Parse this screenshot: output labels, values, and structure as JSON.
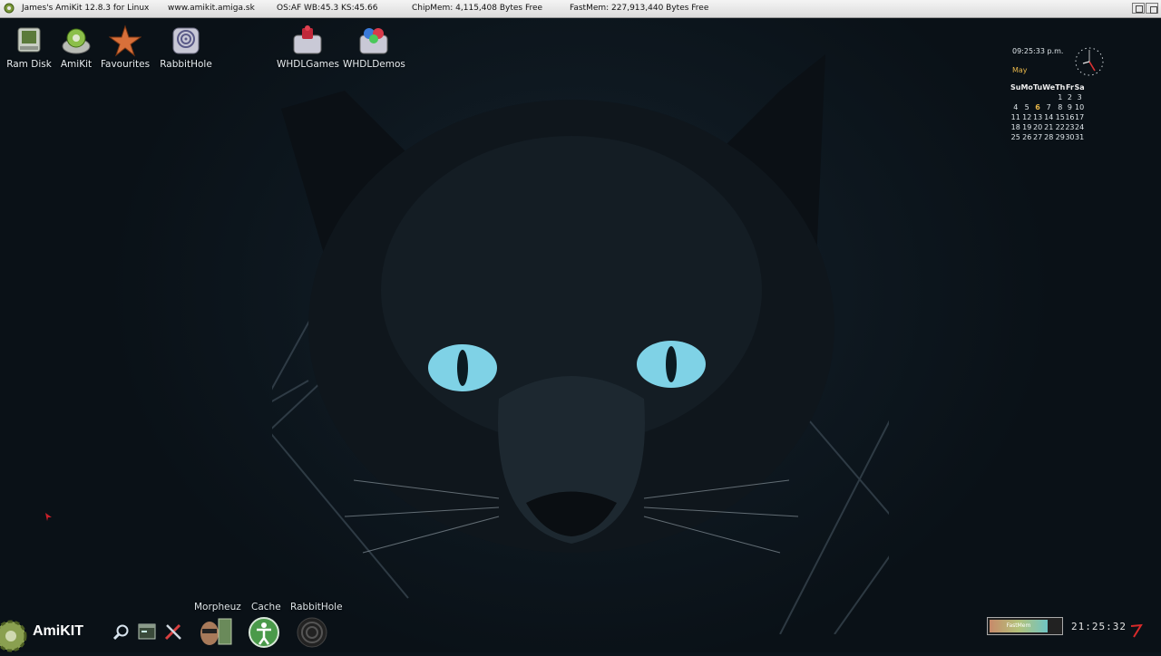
{
  "titlebar": {
    "title": "James's AmiKit 12.8.3 for Linux",
    "website": "www.amikit.amiga.sk",
    "versions": "OS:AF  WB:45.3  KS:45.66",
    "chipmem": "ChipMem: 4,115,408 Bytes Free",
    "fastmem": "FastMem: 227,913,440 Bytes Free"
  },
  "desktop_icons": [
    {
      "label": "Ram Disk",
      "icon": "ram-disk-icon"
    },
    {
      "label": "AmiKit",
      "icon": "amikit-drive-icon"
    },
    {
      "label": "Favourites",
      "icon": "star-icon"
    },
    {
      "label": "RabbitHole",
      "icon": "rabbithole-drive-icon"
    },
    {
      "label": "WHDLGames",
      "icon": "whdl-games-icon"
    },
    {
      "label": "WHDLDemos",
      "icon": "whdl-demos-icon"
    }
  ],
  "calendar": {
    "time": "09:25:33 p.m.",
    "month": "May",
    "weekdays": [
      "Su",
      "Mo",
      "Tu",
      "We",
      "Th",
      "Fr",
      "Sa"
    ],
    "weeks": [
      [
        "",
        "",
        "",
        "",
        "1",
        "2",
        "3"
      ],
      [
        "4",
        "5",
        "6",
        "7",
        "8",
        "9",
        "10"
      ],
      [
        "11",
        "12",
        "13",
        "14",
        "15",
        "16",
        "17"
      ],
      [
        "18",
        "19",
        "20",
        "21",
        "22",
        "23",
        "24"
      ],
      [
        "25",
        "26",
        "27",
        "28",
        "29",
        "30",
        "31"
      ]
    ],
    "today": "6"
  },
  "dock": {
    "logo": "AmiKIT",
    "labels": {
      "morpheuz": "Morpheuz",
      "cache": "Cache",
      "rabbithole": "RabbitHole"
    },
    "fastmem_gauge_label": "FastMem",
    "fastmem_gauge_level": 0.82,
    "clock": "21:25:32"
  },
  "colors": {
    "titlebar": "#e6e6e6",
    "desktop": "#0c141b",
    "calendar_highlight": "#e8b74a",
    "cat_eyes": "#7fd2e6"
  }
}
